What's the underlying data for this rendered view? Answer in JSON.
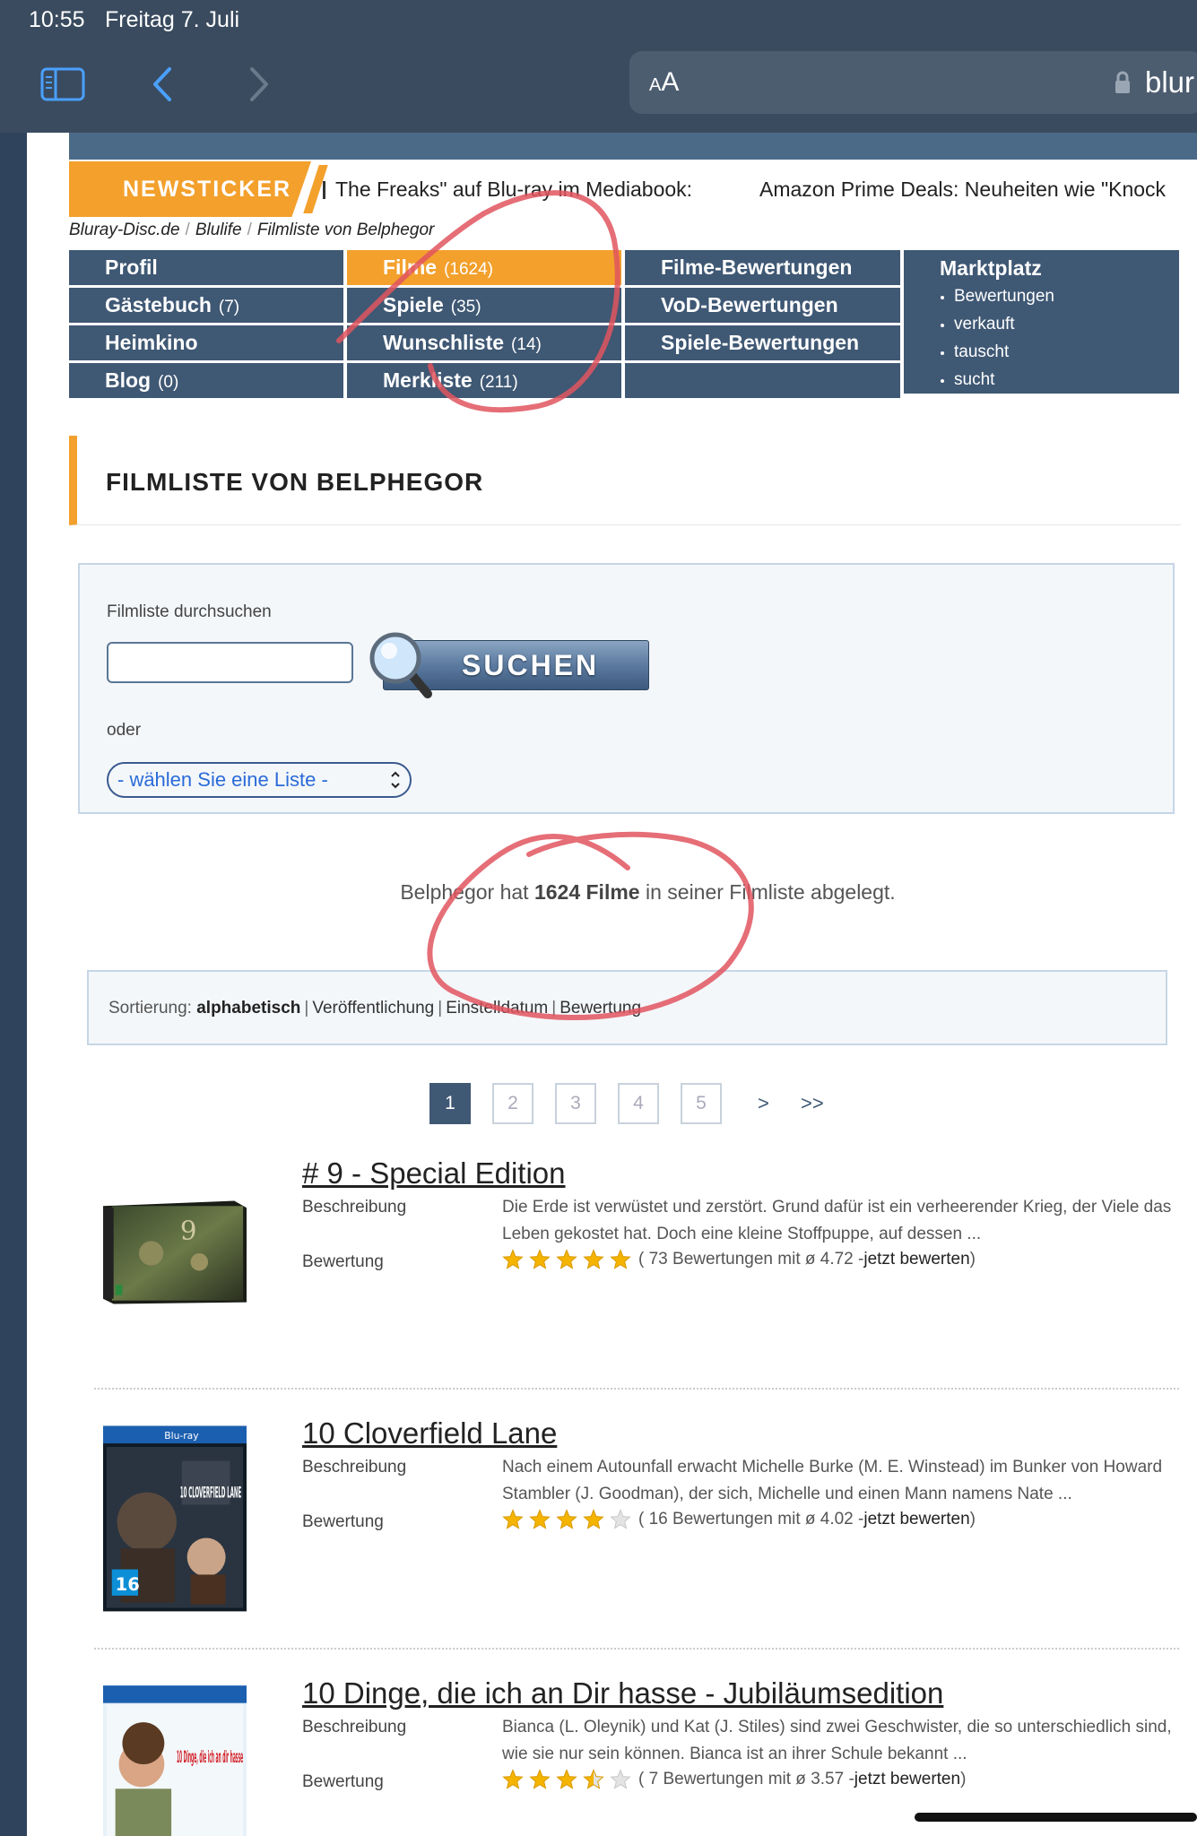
{
  "status_bar": {
    "time": "10:55",
    "date": "Freitag 7. Juli"
  },
  "browser": {
    "text_size_label": "AA",
    "url_partial": "blur"
  },
  "ticker": {
    "label": "NEWSTICKER",
    "items": [
      "The Freaks\" auf Blu-ray im Mediabook:",
      "Amazon Prime Deals: Neuheiten wie \"Knock"
    ]
  },
  "breadcrumb": [
    "Bluray-Disc.de",
    "Blulife",
    "Filmliste von Belphegor"
  ],
  "nav": {
    "col1": [
      {
        "label": "Profil",
        "count": ""
      },
      {
        "label": "Gästebuch",
        "count": "(7)"
      },
      {
        "label": "Heimkino",
        "count": ""
      },
      {
        "label": "Blog",
        "count": "(0)"
      }
    ],
    "col2": [
      {
        "label": "Filme",
        "count": "(1624)"
      },
      {
        "label": "Spiele",
        "count": "(35)"
      },
      {
        "label": "Wunschliste",
        "count": "(14)"
      },
      {
        "label": "Merkliste",
        "count": "(211)"
      }
    ],
    "col3": [
      {
        "label": "Filme-Bewertungen"
      },
      {
        "label": "VoD-Bewertungen"
      },
      {
        "label": "Spiele-Bewertungen"
      }
    ],
    "marketplace": {
      "title": "Marktplatz",
      "items": [
        "Bewertungen",
        "verkauft",
        "tauscht",
        "sucht"
      ]
    }
  },
  "section_title": "FILMLISTE VON BELPHEGOR",
  "search": {
    "label": "Filmliste durchsuchen",
    "input_value": "",
    "button_label": "SUCHEN",
    "or_label": "oder",
    "select_value": "- wählen Sie eine Liste -"
  },
  "summary": {
    "prefix": "Belphegor hat ",
    "count": "1624 Filme",
    "suffix": " in seiner Filmliste abgelegt."
  },
  "sort": {
    "label": "Sortierung:",
    "active": "alphabetisch",
    "options": [
      "Veröffentlichung",
      "Einstelldatum",
      "Bewertung"
    ]
  },
  "pagination": {
    "pages": [
      "1",
      "2",
      "3",
      "4",
      "5"
    ],
    "current": "1",
    "next": ">",
    "last": ">>"
  },
  "items": [
    {
      "title": "# 9 - Special Edition",
      "desc_label": "Beschreibung",
      "description": "Die Erde ist verwüstet und zerstört. Grund dafür ist ein verheerender Krieg, der Viele das Leben gekostet hat. Doch eine kleine Stoffpuppe, auf dessen ...",
      "rating_label": "Bewertung",
      "stars": 5,
      "rating_text": "( 73 Bewertungen mit ø 4.72 - ",
      "rate_link": "jetzt bewerten",
      "rating_close": ")"
    },
    {
      "title": "10 Cloverfield Lane",
      "desc_label": "Beschreibung",
      "description": "Nach einem Autounfall erwacht Michelle Burke (M. E. Winstead) im Bunker von Howard Stambler (J. Goodman), der sich, Michelle und einen Mann namens Nate ...",
      "rating_label": "Bewertung",
      "stars": 4,
      "rating_text": "( 16 Bewertungen mit ø 4.02 - ",
      "rate_link": "jetzt bewerten",
      "rating_close": ")"
    },
    {
      "title": "10 Dinge, die ich an Dir hasse - Jubiläumsedition",
      "desc_label": "Beschreibung",
      "description": "Bianca (L. Oleynik) und Kat (J. Stiles) sind zwei Geschwister, die so unterschiedlich sind, wie sie nur sein können. Bianca ist an ihrer Schule bekannt ...",
      "rating_label": "Bewertung",
      "stars": 3.5,
      "rating_text": "( 7 Bewertungen mit ø 3.57 - ",
      "rate_link": "jetzt bewerten",
      "rating_close": ")"
    }
  ],
  "cover_texts": {
    "cloverfield": "10 CLOVERFIELD LANE",
    "fsk": "16",
    "ten_things": "10 Dinge, die ich an dir hasse"
  },
  "colors": {
    "accent": "#f3a02c",
    "nav": "#3f5874",
    "annotation": "#e0555f"
  }
}
